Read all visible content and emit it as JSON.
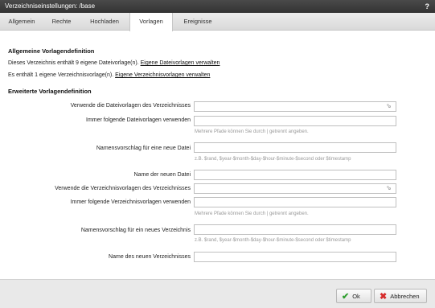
{
  "window": {
    "title": "Verzeichniseinstellungen: /base",
    "help_label": "?"
  },
  "tabs": [
    {
      "label": "Allgemein"
    },
    {
      "label": "Rechte"
    },
    {
      "label": "Hochladen"
    },
    {
      "label": "Vorlagen"
    },
    {
      "label": "Ereignisse"
    }
  ],
  "section_general": {
    "heading": "Allgemeine Vorlagendefinition",
    "line1_text": "Dieses Verzeichnis enthält 9 eigene Dateivorlage(n).",
    "line1_link": "Eigene Dateivorlagen verwalten",
    "line2_text": "Es enthält 1 eigene Verzeichnisvorlage(n).",
    "line2_link": "Eigene Verzeichnisvorlagen verwalten"
  },
  "section_extended": {
    "heading": "Erweiterte Vorlagendefinition",
    "fields": [
      {
        "label": "Verwende die Dateivorlagen des Verzeichnisses",
        "value": "",
        "hint": ""
      },
      {
        "label": "Immer folgende Dateivorlagen verwenden",
        "value": "",
        "hint": "Mehrere Pfade können Sie durch | getrennt angeben."
      },
      {
        "label": "Namensvorschlag für eine neue Datei",
        "value": "",
        "hint": "z.B. $rand, $year-$month-$day-$hour-$minute-$second oder $timestamp"
      },
      {
        "label": "Name der neuen Datei",
        "value": "",
        "hint": ""
      },
      {
        "label": "Verwende die Verzeichnisvorlagen des Verzeichnisses",
        "value": "",
        "hint": ""
      },
      {
        "label": "Immer folgende Verzeichnisvorlagen verwenden",
        "value": "",
        "hint": "Mehrere Pfade können Sie durch | getrennt angeben."
      },
      {
        "label": "Namensvorschlag für ein neues Verzeichnis",
        "value": "",
        "hint": "z.B. $rand, $year-$month-$day-$hour-$minute-$second oder $timestamp"
      },
      {
        "label": "Name des neuen Verzeichnisses",
        "value": "",
        "hint": ""
      }
    ]
  },
  "footer": {
    "ok_label": "Ok",
    "cancel_label": "Abbrechen"
  },
  "colors": {
    "ok_icon": "#2e9e2e",
    "cancel_icon": "#d62b2b",
    "titlebar": "#3a3a3a"
  }
}
